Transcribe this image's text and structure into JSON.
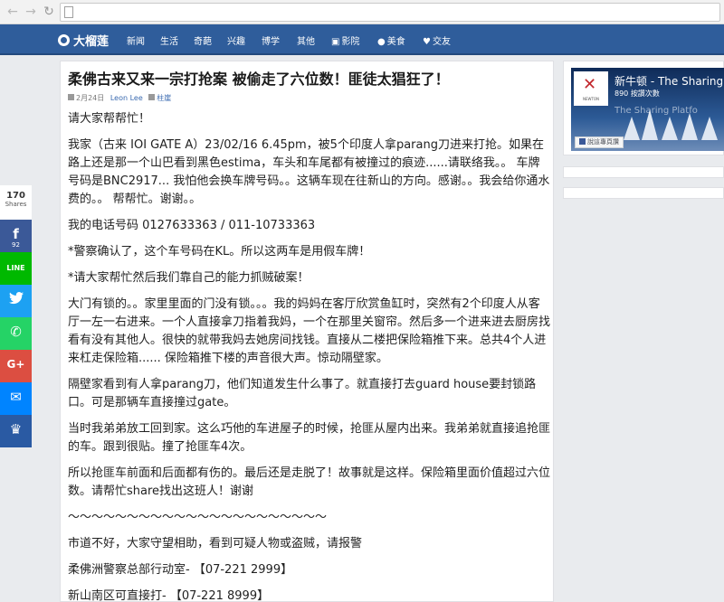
{
  "navbar": {
    "brand": "大榴莲",
    "items": [
      {
        "label": "新闻",
        "icon": ""
      },
      {
        "label": "生活",
        "icon": ""
      },
      {
        "label": "奇葩",
        "icon": ""
      },
      {
        "label": "兴趣",
        "icon": ""
      },
      {
        "label": "博学",
        "icon": ""
      },
      {
        "label": "其他",
        "icon": ""
      },
      {
        "label": "影院",
        "icon": "film-icon"
      },
      {
        "label": "美食",
        "icon": "apple-icon"
      },
      {
        "label": "交友",
        "icon": "heart-icon"
      }
    ]
  },
  "article": {
    "title": "柔佛古来又来一宗打抢案 被偷走了六位数！匪徒太猖狂了！",
    "date": "2月24日",
    "author": "Leon Lee",
    "category": "柱崖",
    "paragraphs": [
      "请大家帮帮忙！",
      "我家（古来 IOI GATE A）23/02/16 6.45pm，被5个印度人拿parang刀进来打抢。如果在路上还是那一个山巴看到黑色estima，车头和车尾都有被撞过的痕迹......请联络我。。 车牌号码是BNC2917... 我怕他会换车牌号码。。这辆车现在往新山的方向。感谢。。我会给你通水费的。。 帮帮忙。谢谢。。",
      "我的电话号码 0127633363 / 011-10733363",
      "*警察确认了，这个车号码在KL。所以这两车是用假车牌！",
      "*请大家帮忙然后我们靠自己的能力抓贼破案！",
      "大门有锁的。。家里里面的门没有锁。。。我的妈妈在客厅欣赏鱼缸时，突然有2个印度人从客厅一左一右进来。一个人直接拿刀指着我妈，一个在那里关窗帘。然后多一个进来进去厨房找看有没有其他人。很快的就带我妈去她房间找钱。直接从二楼把保险箱推下来。总共4个人进来杠走保险箱...... 保险箱推下楼的声音很大声。惊动隔壁家。",
      "隔壁家看到有人拿parang刀，他们知道发生什么事了。就直接打去guard house要封锁路口。可是那辆车直接撞过gate。",
      "当时我弟弟放工回到家。这么巧他的车进屋子的时候，抢匪从屋内出来。我弟弟就直接追抢匪的车。跟到很贴。撞了抢匪车4次。",
      "所以抢匪车前面和后面都有伤的。最后还是走脱了！故事就是这样。保险箱里面价值超过六位数。请帮忙share找出这班人！谢谢",
      "～～～～～～～～～～～～～～～～～～～～～～",
      "市道不好，大家守望相助，看到可疑人物或盗贼，请报警",
      "柔佛洲警察总部行动室- 【07-221 2999】",
      "新山南区可直接打- 【07-221 8999】"
    ]
  },
  "share": {
    "count": "170",
    "count_label": "Shares",
    "facebook_count": "92",
    "buttons": [
      {
        "name": "facebook",
        "glyph": "f"
      },
      {
        "name": "line",
        "glyph": "LINE"
      },
      {
        "name": "twitter",
        "glyph": "🐦"
      },
      {
        "name": "whatsapp",
        "glyph": "✆"
      },
      {
        "name": "google-plus",
        "glyph": "G+"
      },
      {
        "name": "messenger",
        "glyph": "✉"
      },
      {
        "name": "more",
        "glyph": "♛"
      }
    ]
  },
  "sidebar": {
    "fb_page_name": "新牛顿 - The Sharing",
    "fb_likes": "890 按讚次數",
    "fb_watermark": "The Sharing Platfo",
    "fb_logo_text": "NEWTON",
    "fb_button": "說這專頁讚"
  },
  "colors": {
    "navbar": "#2f5d9b",
    "facebook": "#3b5998",
    "line": "#00b900",
    "twitter": "#1da1f2",
    "whatsapp": "#25d366",
    "google_plus": "#dc4e41",
    "messenger": "#0084ff",
    "more": "#2a5aa3"
  }
}
